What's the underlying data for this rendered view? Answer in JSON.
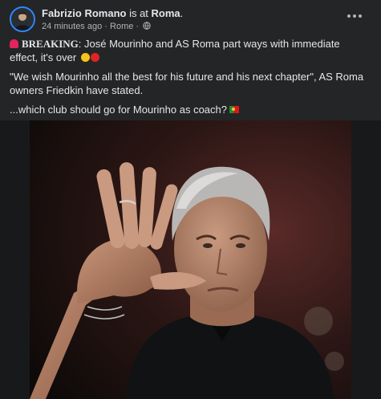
{
  "post": {
    "author": "Fabrizio Romano",
    "location_prefix": "is at",
    "location": "Roma",
    "location_suffix": ".",
    "timestamp": "24 minutes ago",
    "separator1": "·",
    "place": "Rome",
    "separator2": "·",
    "privacy_icon": "globe-icon",
    "breaking_label": "BREAKING",
    "line1": ": José Mourinho and AS Roma part ways with immediate effect, it's over",
    "line2": "\"We wish Mourinho all the best for his future and his next chapter\", AS Roma owners Friedkin have stated.",
    "line3": "...which club should go for Mourinho as coach?",
    "emoji": [
      "siren-icon",
      "yellow-circle-icon",
      "red-circle-icon",
      "portugal-flag-icon"
    ]
  },
  "colors": {
    "card_bg": "#242526",
    "text": "#e4e6eb",
    "secondary_text": "#b0b3b8",
    "avatar_ring": "#2d88ff"
  }
}
